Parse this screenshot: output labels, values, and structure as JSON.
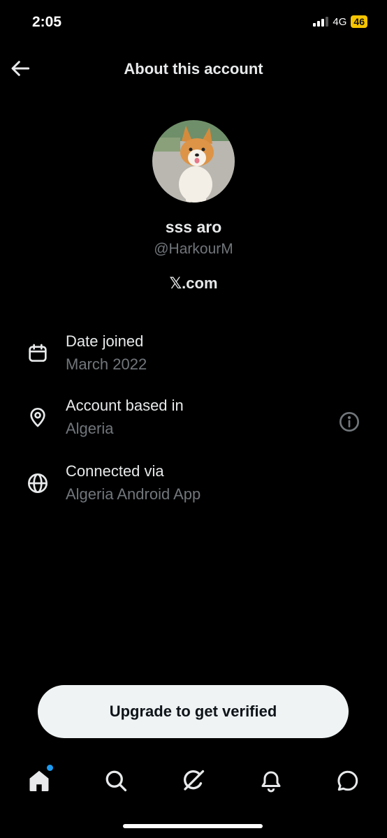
{
  "status_bar": {
    "time": "2:05",
    "network": "4G",
    "battery": "46"
  },
  "header": {
    "title": "About this account",
    "back_icon": "back-arrow-icon"
  },
  "profile": {
    "display_name": "sss aro",
    "handle": "@HarkourM",
    "site": "𝕏.com"
  },
  "details": [
    {
      "icon": "calendar-icon",
      "label": "Date joined",
      "value": "March 2022"
    },
    {
      "icon": "location-pin-icon",
      "label": "Account based in",
      "value": "Algeria"
    },
    {
      "icon": "globe-icon",
      "label": "Connected via",
      "value": "Algeria Android App"
    }
  ],
  "upgrade_button": "Upgrade to get verified",
  "tabs": [
    "home-icon",
    "search-icon",
    "grok-icon",
    "notifications-icon",
    "messages-icon"
  ],
  "colors": {
    "accent": "#1d9bf0",
    "secondary_text": "#71767b",
    "battery": "#f5c400"
  }
}
